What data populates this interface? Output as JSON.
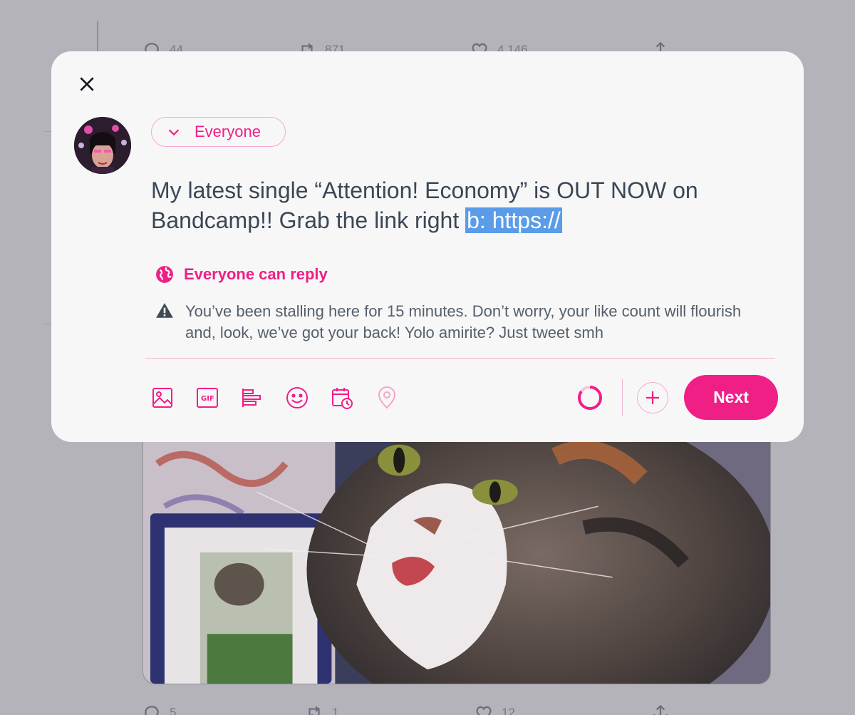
{
  "background": {
    "tweet_top_actions": {
      "reply_count": "44",
      "retweet_count": "871",
      "like_count": "4,146"
    },
    "tweet_bottom_actions": {
      "reply_count": "5",
      "retweet_count": "1",
      "like_count": "12"
    }
  },
  "composer": {
    "audience_label": "Everyone",
    "text_before_selection": "My latest single “Attention! Economy” is OUT NOW on Bandcamp!! Grab the link right ",
    "text_selected": "b: https://",
    "reply_setting_label": "Everyone can reply",
    "warning_text": "You’ve been stalling here for 15 minutes. Don’t worry, your like count will flourish and, look, we’ve got your back! Yolo amirite? Just tweet smh",
    "character_progress": 0.85,
    "next_label": "Next",
    "toolbar_icons": [
      "image-icon",
      "gif-icon",
      "poll-icon",
      "emoji-icon",
      "schedule-icon",
      "location-icon"
    ]
  },
  "colors": {
    "accent": "#f01f86",
    "accent_light": "#f7a8cf",
    "selection": "#5b9ce8",
    "text": "#3b4754",
    "overlay_background": "#b4b3b9"
  }
}
